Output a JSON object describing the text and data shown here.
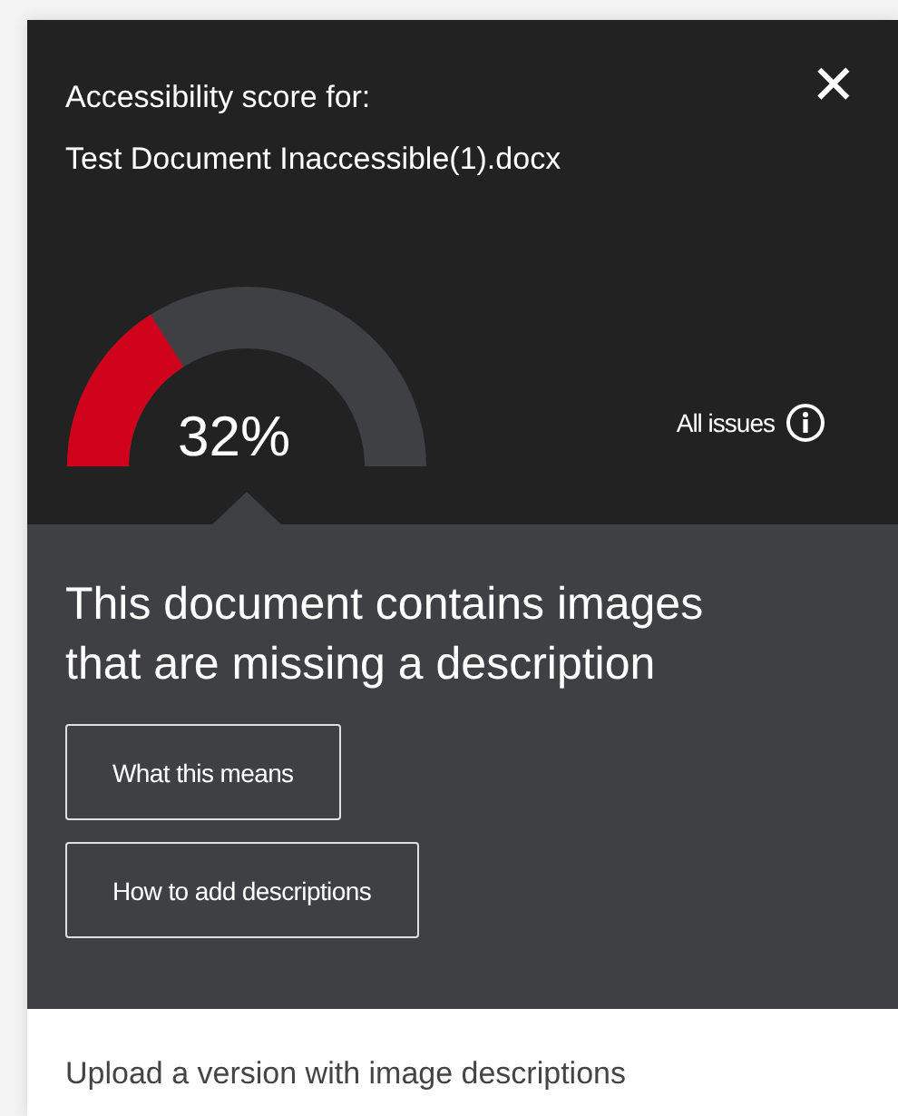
{
  "header": {
    "title": "Accessibility score for:",
    "document": "Test Document Inaccessible(1).docx",
    "close": "✕"
  },
  "score": {
    "reading": "32%"
  },
  "all_issues": {
    "label": "All issues"
  },
  "issue": {
    "title": "This document contains images that are missing a description",
    "buttons": [
      "What this means",
      "How to add descriptions"
    ]
  },
  "footer": {
    "text": "Upload a version with image descriptions"
  }
}
